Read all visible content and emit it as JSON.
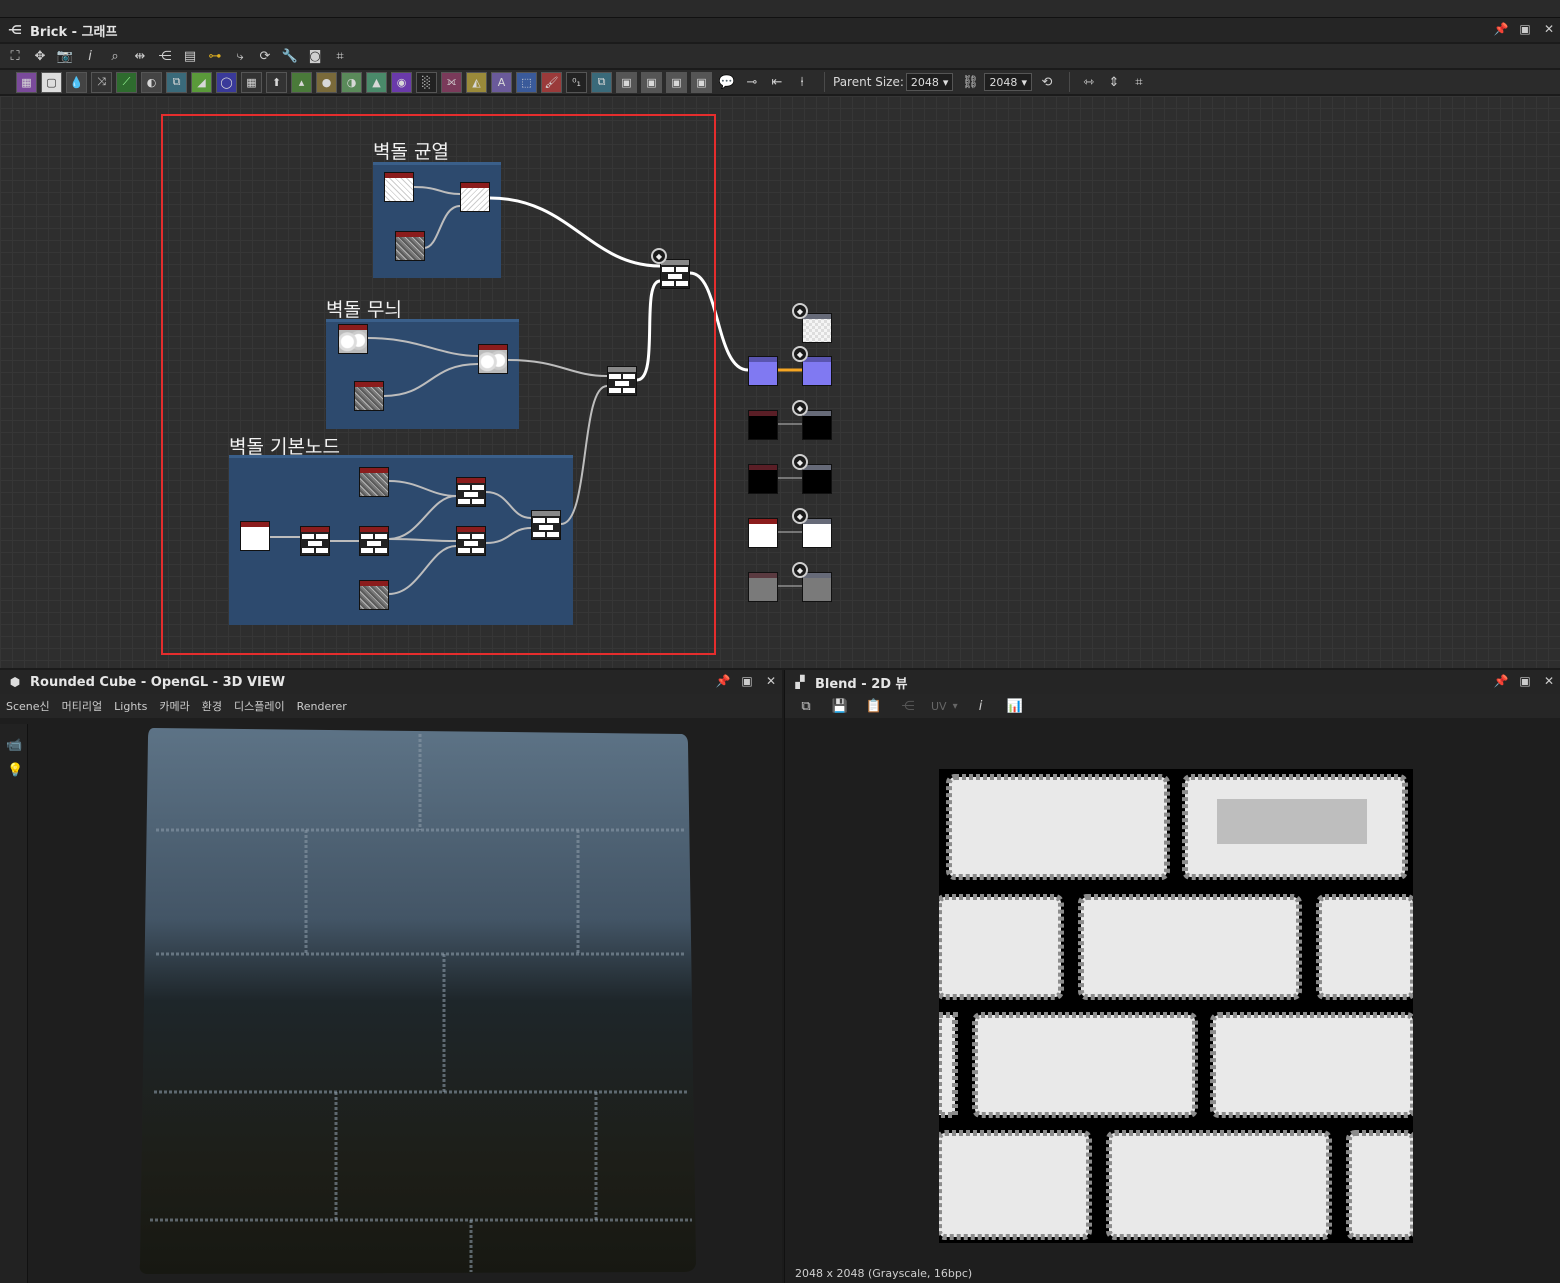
{
  "graph_panel": {
    "title": "Brick - 그래프",
    "parent_size_label": "Parent Size:",
    "parent_size_value": "2048",
    "output_size_value": "2048"
  },
  "frames": {
    "crack": "벽돌 균열",
    "pattern": "벽돌 무늬",
    "base": "벽돌 기본노드"
  },
  "view3d": {
    "title": "Rounded Cube - OpenGL - 3D VIEW",
    "menu": [
      "Scene신",
      "머티리얼",
      "Lights",
      "카메라",
      "환경",
      "디스플레이",
      "Renderer"
    ]
  },
  "view2d": {
    "title": "Blend - 2D 뷰",
    "uv_label": "UV",
    "status": "2048 x 2048 (Grayscale, 16bpc)"
  },
  "colors": {
    "selection": "#e52d2d",
    "frame": "#2d4a6e",
    "normal_node": "#8079f2",
    "link_highlight": "#f5a623"
  }
}
